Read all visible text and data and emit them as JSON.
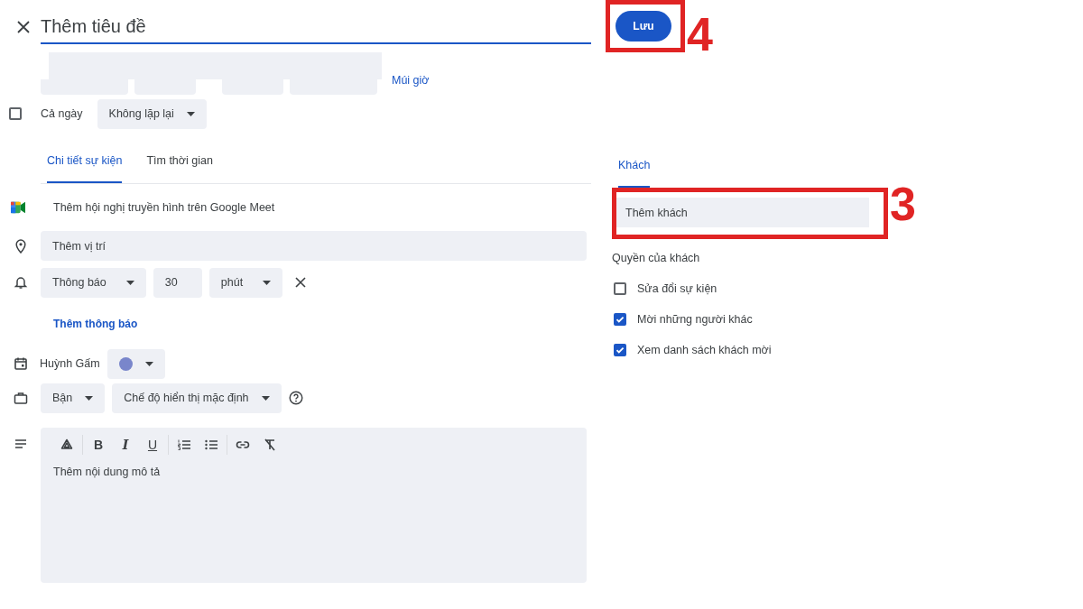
{
  "title_field": {
    "placeholder": "Thêm tiêu đề"
  },
  "save_button": {
    "label": "Lưu",
    "annotation": "4"
  },
  "date_row": {
    "timezone_link": "Múi giờ"
  },
  "all_day": {
    "label": "Cả ngày",
    "checked": false
  },
  "repeat": "Không lặp lại",
  "detail_tabs": [
    {
      "label": "Chi tiết sự kiện",
      "selected": true
    },
    {
      "label": "Tìm thời gian",
      "selected": false
    }
  ],
  "meet": "Thêm hội nghị truyền hình trên Google Meet",
  "location": {
    "placeholder": "Thêm vị trí"
  },
  "notification": {
    "type": "Thông báo",
    "amount": "30",
    "unit": "phút"
  },
  "add_notification": "Thêm thông báo",
  "calendar": {
    "owner": "Huỳnh Gấm",
    "color": "#7986cb"
  },
  "availability": "Bận",
  "visibility": "Chế độ hiển thị mặc định",
  "toolbar": [
    {
      "kind": "drive"
    },
    {
      "kind": "sep"
    },
    {
      "kind": "bold",
      "label": "B"
    },
    {
      "kind": "italic",
      "label": "I"
    },
    {
      "kind": "underline",
      "label": "U"
    },
    {
      "kind": "sep"
    },
    {
      "kind": "numbered"
    },
    {
      "kind": "bulleted"
    },
    {
      "kind": "sep"
    },
    {
      "kind": "link"
    },
    {
      "kind": "clear"
    }
  ],
  "description": {
    "placeholder": "Thêm nội dung mô tả"
  },
  "guest_tabs": [
    {
      "label": "Khách",
      "selected": true
    }
  ],
  "guests": {
    "placeholder": "Thêm khách",
    "annotation": "3"
  },
  "permissions_title": "Quyền của khách",
  "permissions": [
    {
      "label": "Sửa đổi sự kiện",
      "checked": false
    },
    {
      "label": "Mời những người khác",
      "checked": true
    },
    {
      "label": "Xem danh sách khách mời",
      "checked": true
    }
  ]
}
